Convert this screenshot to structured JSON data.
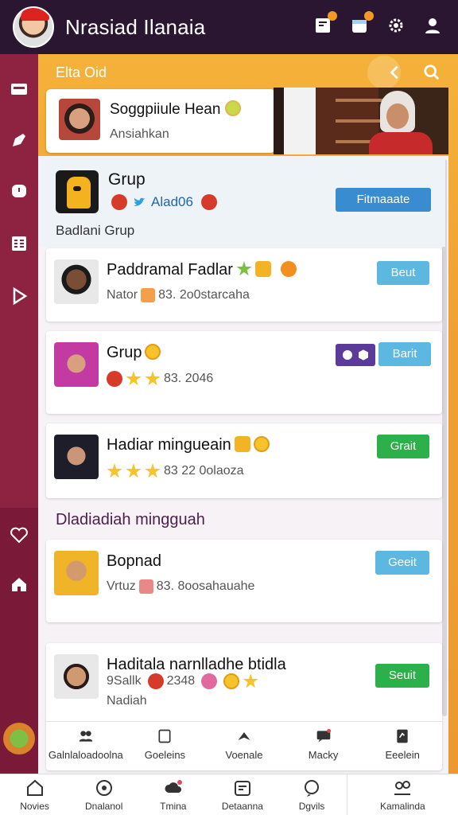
{
  "app": {
    "title": "Nrasiad Ilanaia"
  },
  "header": {
    "section_label": "Elta Oid"
  },
  "featured": {
    "name": "Soggpiiule Hean",
    "subtitle": "Ansiahkan"
  },
  "group": {
    "title": "Grup",
    "meta": "Alad06",
    "button": "Fitmaaate",
    "subtitle": "Badlani Grup"
  },
  "cards": [
    {
      "title": "Paddramal Fadlar",
      "meta": "Nator",
      "meta_value": "83. 2o0starcaha",
      "button": "Beut"
    },
    {
      "title": "Grup",
      "meta": "",
      "meta_value": "83. 2046",
      "button": "Barit"
    },
    {
      "title": "Hadiar mingueain",
      "meta": "",
      "meta_value": "83 22 0olaoza",
      "button": "Grait"
    }
  ],
  "section2": {
    "label": "Dladiadiah mingguah"
  },
  "cards2": [
    {
      "title": "Bopnad",
      "meta": "Vrtuz",
      "meta_value": "83. 8oosahauahe",
      "button": "Geeit"
    },
    {
      "title": "Haditala narnlladhe btidla",
      "meta": "9Sallk",
      "meta_value": "2348",
      "sub": "Nadiah",
      "button": "Seuit"
    }
  ],
  "subtabs": [
    {
      "label": "Galnlaloadoolna",
      "icon": "people-icon"
    },
    {
      "label": "Goeleins",
      "icon": "note-icon"
    },
    {
      "label": "Voenale",
      "icon": "share-icon"
    },
    {
      "label": "Macky",
      "icon": "chat-icon"
    },
    {
      "label": "Eeelein",
      "icon": "document-icon"
    }
  ],
  "bottomnav": [
    {
      "label": "Novies",
      "icon": "home-icon"
    },
    {
      "label": "Dnalanol",
      "icon": "compass-icon"
    },
    {
      "label": "Tmina",
      "icon": "cloud-icon"
    },
    {
      "label": "Detaanna",
      "icon": "calendar-icon"
    },
    {
      "label": "Dgvils",
      "icon": "chat-bubble-icon"
    },
    {
      "label": "Kamalinda",
      "icon": "profile-icon"
    }
  ],
  "colors": {
    "topbar": "#2a1630",
    "rail": "#8e2241",
    "accent_orange": "#f0a032",
    "button_blue": "#3a8cd0",
    "button_green": "#2bb04a"
  }
}
